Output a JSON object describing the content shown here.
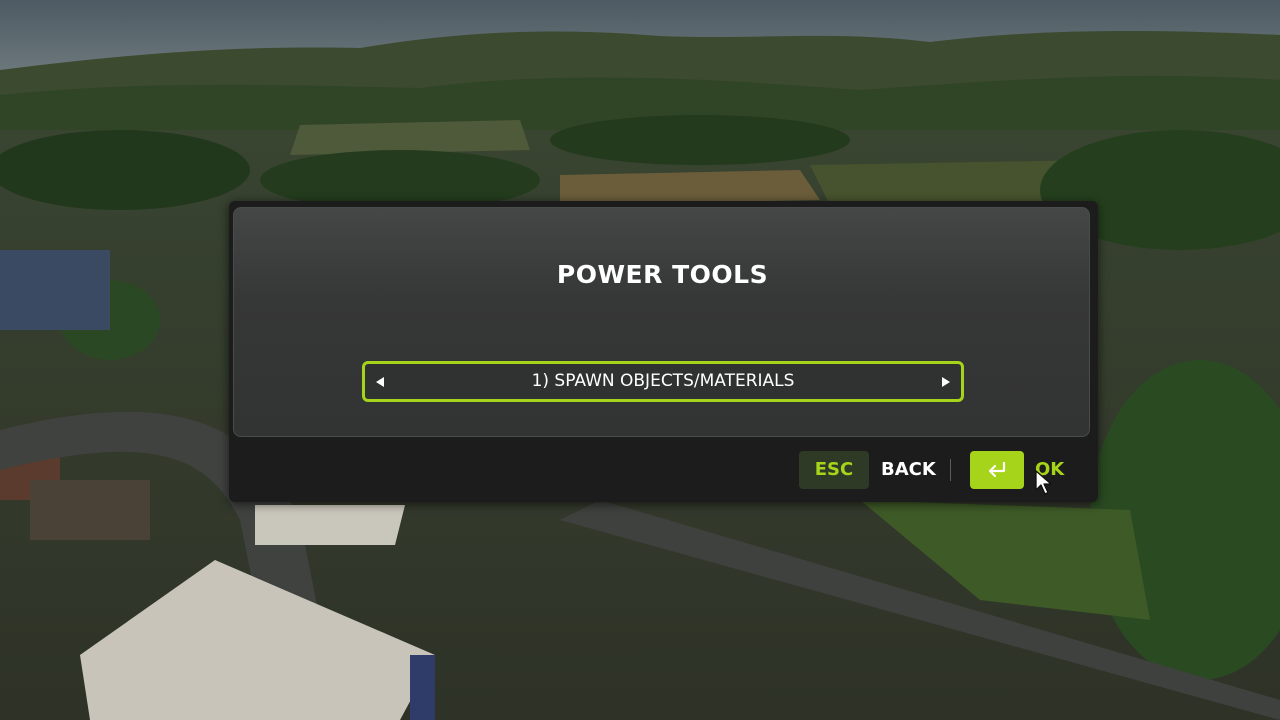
{
  "dialog": {
    "title": "POWER TOOLS",
    "selector": {
      "value": "1) SPAWN OBJECTS/MATERIALS"
    }
  },
  "footer": {
    "esc_key": "ESC",
    "back_label": "BACK",
    "enter_icon": "enter-key-icon",
    "ok_label": "OK"
  },
  "colors": {
    "accent": "#a5d41a",
    "dialog_bg": "#1b1c1b",
    "panel_bg": "#363737"
  }
}
